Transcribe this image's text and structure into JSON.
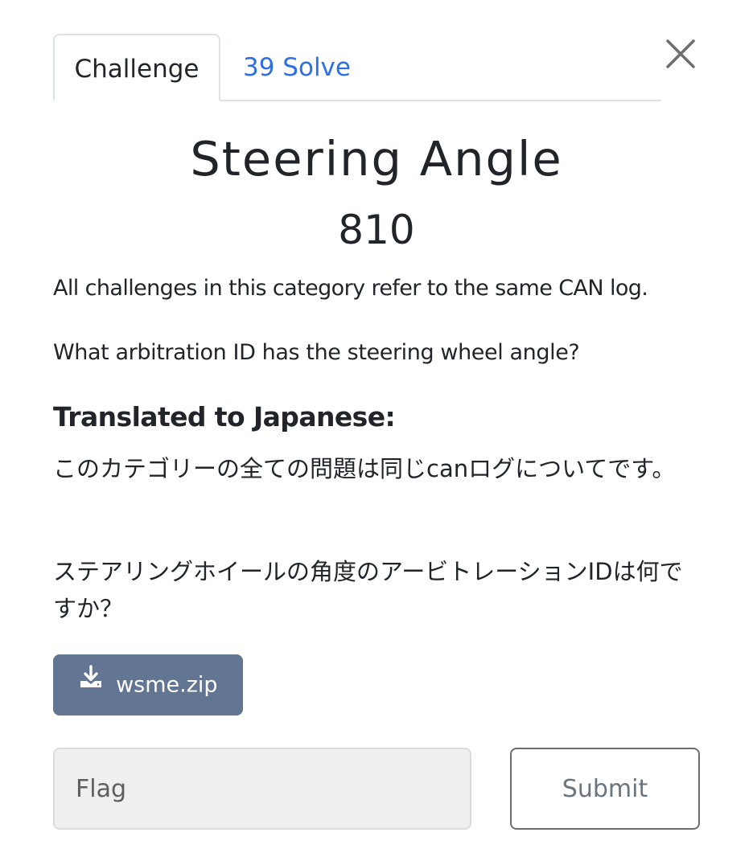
{
  "tabs": {
    "challenge_label": "Challenge",
    "solves_label": "39 Solve"
  },
  "challenge": {
    "name": "Steering Angle",
    "value": "810",
    "description_1": "All challenges in this category refer to the same CAN log.",
    "description_2": "What arbitration ID has the steering wheel angle?",
    "translation_heading": "Translated to Japanese:",
    "japanese_1": "このカテゴリーの全ての問題は同じcanログについてです。",
    "japanese_2": "ステアリングホイールの角度のアービトレーションIDは何ですか？"
  },
  "files": {
    "download_label": "wsme.zip",
    "icon": "download-icon"
  },
  "submission": {
    "flag_placeholder": "Flag",
    "flag_value": "",
    "submit_label": "Submit"
  },
  "colors": {
    "tab_link": "#2f6fe4",
    "download_bg": "#627592",
    "input_bg": "#efefef"
  }
}
